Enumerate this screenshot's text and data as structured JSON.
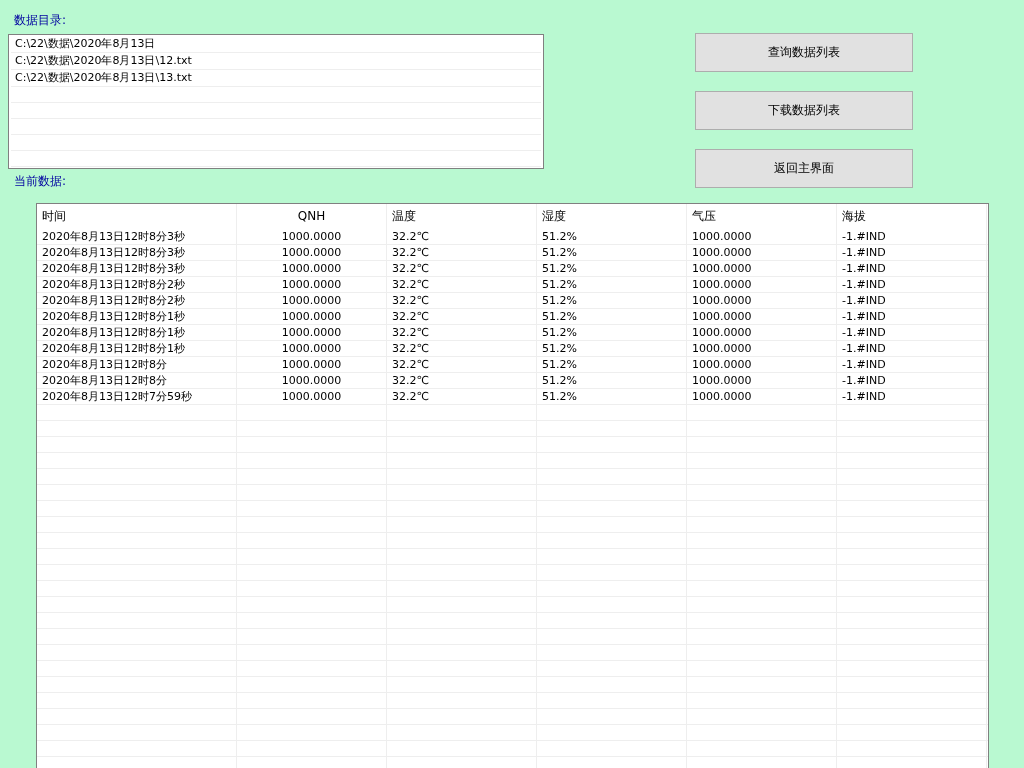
{
  "directory_label": "数据目录:",
  "directory_list": [
    "C:\\22\\数据\\2020年8月13日",
    "C:\\22\\数据\\2020年8月13日\\12.txt",
    "C:\\22\\数据\\2020年8月13日\\13.txt"
  ],
  "buttons": [
    "查询数据列表",
    "下载数据列表",
    "返回主界面"
  ],
  "current_label": "当前数据:",
  "table": {
    "columns": [
      "时间",
      "QNH",
      "温度",
      "湿度",
      "气压",
      "海拔"
    ],
    "rows": [
      [
        "2020年8月13日12时8分3秒",
        "1000.0000",
        "32.2℃",
        "51.2%",
        "1000.0000",
        "-1.#IND"
      ],
      [
        "2020年8月13日12时8分3秒",
        "1000.0000",
        "32.2℃",
        "51.2%",
        "1000.0000",
        "-1.#IND"
      ],
      [
        "2020年8月13日12时8分3秒",
        "1000.0000",
        "32.2℃",
        "51.2%",
        "1000.0000",
        "-1.#IND"
      ],
      [
        "2020年8月13日12时8分2秒",
        "1000.0000",
        "32.2℃",
        "51.2%",
        "1000.0000",
        "-1.#IND"
      ],
      [
        "2020年8月13日12时8分2秒",
        "1000.0000",
        "32.2℃",
        "51.2%",
        "1000.0000",
        "-1.#IND"
      ],
      [
        "2020年8月13日12时8分1秒",
        "1000.0000",
        "32.2℃",
        "51.2%",
        "1000.0000",
        "-1.#IND"
      ],
      [
        "2020年8月13日12时8分1秒",
        "1000.0000",
        "32.2℃",
        "51.2%",
        "1000.0000",
        "-1.#IND"
      ],
      [
        "2020年8月13日12时8分1秒",
        "1000.0000",
        "32.2℃",
        "51.2%",
        "1000.0000",
        "-1.#IND"
      ],
      [
        "2020年8月13日12时8分",
        "1000.0000",
        "32.2℃",
        "51.2%",
        "1000.0000",
        "-1.#IND"
      ],
      [
        "2020年8月13日12时8分",
        "1000.0000",
        "32.2℃",
        "51.2%",
        "1000.0000",
        "-1.#IND"
      ],
      [
        "2020年8月13日12时7分59秒",
        "1000.0000",
        "32.2℃",
        "51.2%",
        "1000.0000",
        "-1.#IND"
      ]
    ]
  }
}
